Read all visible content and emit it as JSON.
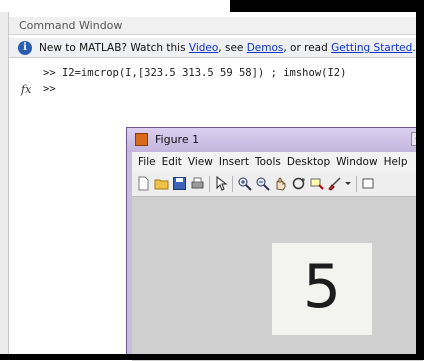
{
  "command_window": {
    "title": "Command Window",
    "info": {
      "prefix": "New to MATLAB? Watch this ",
      "video_link": "Video",
      "mid1": ", see ",
      "demos_link": "Demos",
      "mid2": ", or read ",
      "started_link": "Getting Started",
      "suffix": "."
    },
    "lines": [
      ">> I2=imcrop(I,[323.5 313.5 59 58]) ; imshow(I2)",
      ">>"
    ],
    "fx_label": "fx"
  },
  "figure": {
    "title": "Figure 1",
    "menu": [
      "File",
      "Edit",
      "View",
      "Insert",
      "Tools",
      "Desktop",
      "Window",
      "Help"
    ],
    "image_digit": "5"
  },
  "colors": {
    "link": "#1033c9",
    "figure_frame": "#c9bcdc",
    "info_icon": "#2a5db0"
  }
}
